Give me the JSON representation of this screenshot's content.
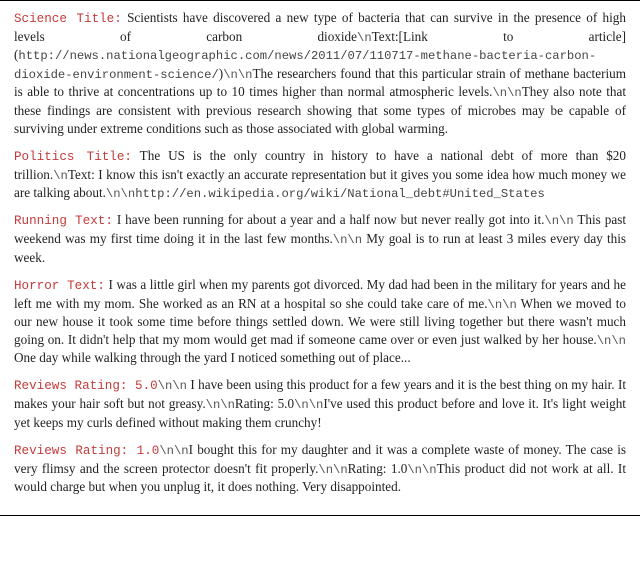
{
  "entries": [
    {
      "prefix": "Science Title:",
      "segments": [
        {
          "t": "text",
          "v": " Scientists have discovered a new type of bacteria that can survive in the presence of high levels of carbon dioxide"
        },
        {
          "t": "nl",
          "v": "\\n"
        },
        {
          "t": "text",
          "v": "Text:[Link to article] ("
        },
        {
          "t": "mono",
          "v": "http://news.nationalgeographic.com/news/2011/07/110717-methane-bacteria-carbon-dioxide-environment-science/"
        },
        {
          "t": "text",
          "v": ")"
        },
        {
          "t": "nl",
          "v": "\\n\\n"
        },
        {
          "t": "text",
          "v": "The researchers found that this particular strain of methane bacterium is able to thrive at concentrations up to 10 times higher than normal atmospheric levels."
        },
        {
          "t": "nl",
          "v": "\\n\\n"
        },
        {
          "t": "text",
          "v": "They also note that these findings are consistent with previous research showing that some types of microbes may be capable of surviving under extreme conditions such as those associated with global warming."
        }
      ]
    },
    {
      "prefix": "Politics Title:",
      "segments": [
        {
          "t": "text",
          "v": " The US is the only country in history to have a national debt of more than $20 trillion."
        },
        {
          "t": "nl",
          "v": "\\n"
        },
        {
          "t": "text",
          "v": "Text: I know this isn't exactly an accurate representation but it gives you some idea how much money we are talking about."
        },
        {
          "t": "nl",
          "v": "\\n\\n"
        },
        {
          "t": "mono",
          "v": "http://en.wikipedia.org/wiki/National_debt#United_States"
        }
      ]
    },
    {
      "prefix": "Running Text:",
      "segments": [
        {
          "t": "text",
          "v": " I have been running for about a year and a half now but never really got into it."
        },
        {
          "t": "nl",
          "v": "\\n\\n"
        },
        {
          "t": "text",
          "v": " This past weekend was my first time doing it in the last few months."
        },
        {
          "t": "nl",
          "v": "\\n\\n"
        },
        {
          "t": "text",
          "v": " My goal is to run at least 3 miles every day this week."
        }
      ]
    },
    {
      "prefix": "Horror Text:",
      "segments": [
        {
          "t": "text",
          "v": " I was a little girl when my parents got divorced. My dad had been in the military for years and he left me with my mom. She worked as an RN at a hospital so she could take care of me."
        },
        {
          "t": "nl",
          "v": "\\n\\n"
        },
        {
          "t": "text",
          "v": " When we moved to our new house it took some time before things settled down. We were still living together but there wasn't much going on. It didn't help that my mom would get mad if someone came over or even just walked by her house."
        },
        {
          "t": "nl",
          "v": "\\n\\n"
        },
        {
          "t": "text",
          "v": " One day while walking through the yard I noticed something out of place..."
        }
      ]
    },
    {
      "prefix": "Reviews Rating: 5.0",
      "segments": [
        {
          "t": "nl",
          "v": "\\n\\n"
        },
        {
          "t": "text",
          "v": " I have been using this product for a few years and it is the best thing on my hair. It makes your hair soft but not greasy."
        },
        {
          "t": "nl",
          "v": "\\n\\n"
        },
        {
          "t": "text",
          "v": "Rating: 5.0"
        },
        {
          "t": "nl",
          "v": "\\n\\n"
        },
        {
          "t": "text",
          "v": "I've used this product before and love it. It's light weight yet keeps my curls defined without making them crunchy!"
        }
      ]
    },
    {
      "prefix": "Reviews Rating: 1.0",
      "segments": [
        {
          "t": "nl",
          "v": "\\n\\n"
        },
        {
          "t": "text",
          "v": "I bought this for my daughter and it was a complete waste of money. The case is very flimsy and the screen protector doesn't fit properly."
        },
        {
          "t": "nl",
          "v": "\\n\\n"
        },
        {
          "t": "text",
          "v": "Rating: 1.0"
        },
        {
          "t": "nl",
          "v": "\\n\\n"
        },
        {
          "t": "text",
          "v": "This product did not work at all. It would charge but when you unplug it, it does nothing. Very disappointed."
        }
      ]
    }
  ]
}
